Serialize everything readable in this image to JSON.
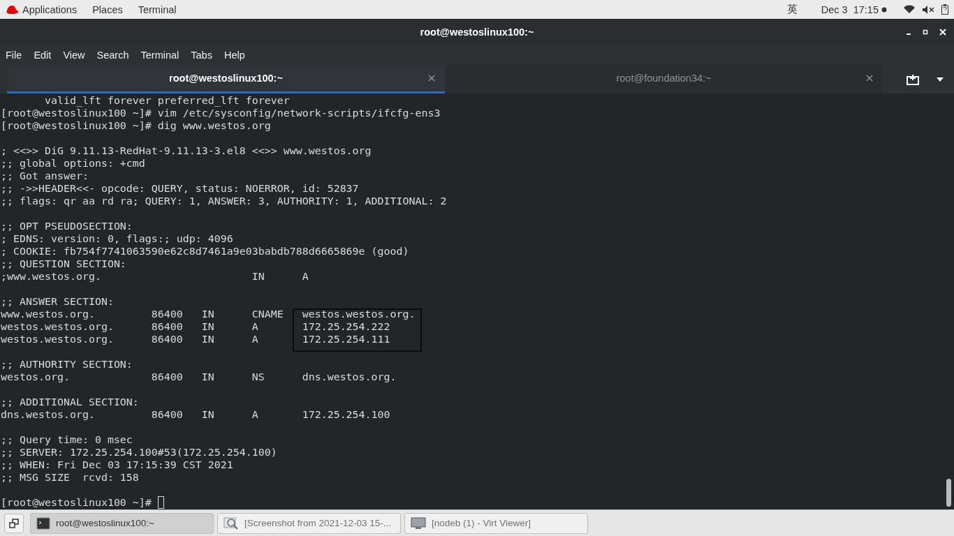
{
  "top_bar": {
    "menus": [
      "Applications",
      "Places",
      "Terminal"
    ],
    "input_method": "英",
    "clock": "Dec 3  17:15"
  },
  "window": {
    "title": "root@westoslinux100:~"
  },
  "menu_bar": [
    "File",
    "Edit",
    "View",
    "Search",
    "Terminal",
    "Tabs",
    "Help"
  ],
  "tabs": [
    {
      "label": "root@westoslinux100:~",
      "selected": true
    },
    {
      "label": "root@foundation34:~",
      "selected": false
    }
  ],
  "terminal": {
    "blocks": [
      [
        "       valid_lft forever preferred_lft forever",
        "[root@westoslinux100 ~]# vim /etc/sysconfig/network-scripts/ifcfg-ens3",
        "[root@westoslinux100 ~]# dig www.westos.org"
      ],
      [
        "; <<>> DiG 9.11.13-RedHat-9.11.13-3.el8 <<>> www.westos.org",
        ";; global options: +cmd",
        ";; Got answer:",
        ";; ->>HEADER<<- opcode: QUERY, status: NOERROR, id: 52837",
        ";; flags: qr aa rd ra; QUERY: 1, ANSWER: 3, AUTHORITY: 1, ADDITIONAL: 2"
      ],
      [
        ";; OPT PSEUDOSECTION:",
        "; EDNS: version: 0, flags:; udp: 4096",
        "; COOKIE: fb754f7741063590e62c8d7461a9e03babdb788d6665869e (good)",
        ";; QUESTION SECTION:",
        ";www.westos.org.                        IN      A"
      ],
      [
        ";; ANSWER SECTION:",
        "www.westos.org.         86400   IN      CNAME   westos.westos.org.",
        "westos.westos.org.      86400   IN      A       172.25.254.222",
        "westos.westos.org.      86400   IN      A       172.25.254.111"
      ],
      [
        ";; AUTHORITY SECTION:",
        "westos.org.             86400   IN      NS      dns.westos.org."
      ],
      [
        ";; ADDITIONAL SECTION:",
        "dns.westos.org.         86400   IN      A       172.25.254.100"
      ],
      [
        ";; Query time: 0 msec",
        ";; SERVER: 172.25.254.100#53(172.25.254.100)",
        ";; WHEN: Fri Dec 03 17:15:39 CST 2021",
        ";; MSG SIZE  rcvd: 158"
      ]
    ],
    "prompt": "[root@westoslinux100 ~]# "
  },
  "taskbar": [
    {
      "label": "root@westoslinux100:~",
      "selected": true,
      "kind": "terminal"
    },
    {
      "label": "[Screenshot from 2021-12-03 15-...",
      "selected": false,
      "kind": "image"
    },
    {
      "label": "[nodeb (1) - Virt Viewer]",
      "selected": false,
      "kind": "viewer"
    }
  ]
}
